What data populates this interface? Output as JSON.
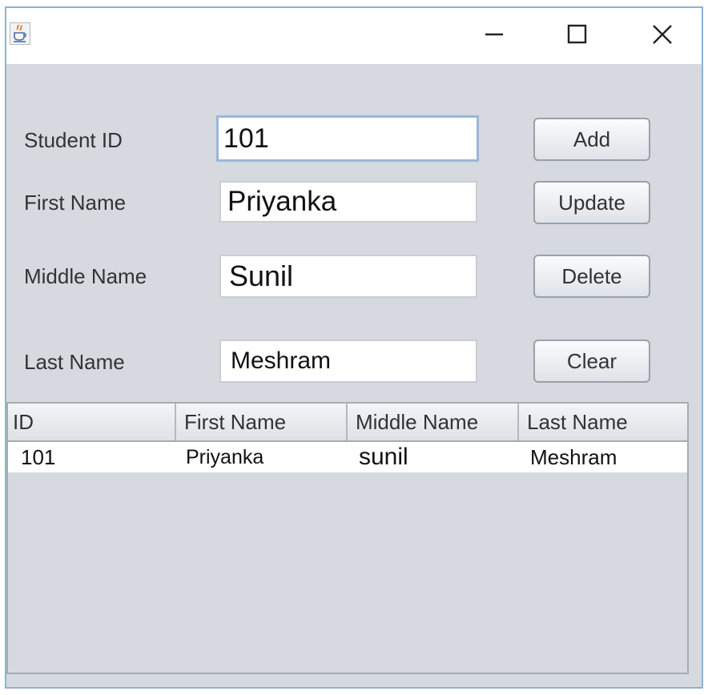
{
  "titlebar": {
    "app_icon": "java-cup-icon",
    "minimize_icon": "minimize-icon",
    "maximize_icon": "maximize-icon",
    "close_icon": "close-icon"
  },
  "form": {
    "student_id_label": "Student ID",
    "student_id_value": "101",
    "first_name_label": "First Name",
    "first_name_value": "Priyanka",
    "middle_name_label": "Middle Name",
    "middle_name_value": "Sunil",
    "last_name_label": "Last Name",
    "last_name_value": "Meshram"
  },
  "buttons": {
    "add": "Add",
    "update": "Update",
    "delete": "Delete",
    "clear": "Clear"
  },
  "table": {
    "columns": [
      "ID",
      "First Name",
      "Middle Name",
      "Last Name"
    ],
    "rows": [
      [
        "101",
        "Priyanka",
        "sunil",
        "Meshram"
      ]
    ]
  },
  "colors": {
    "panel_background": "#d6d9e0",
    "focus_border": "#9db6d6",
    "window_border": "#8fb2d6"
  }
}
